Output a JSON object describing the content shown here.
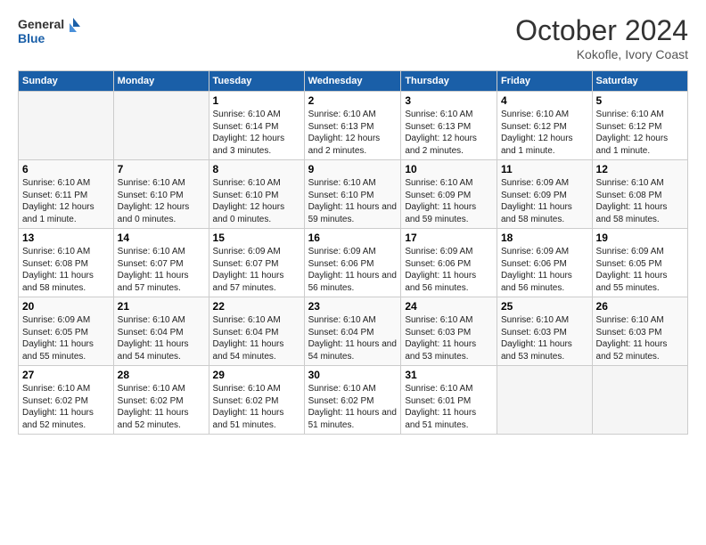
{
  "logo": {
    "line1": "General",
    "line2": "Blue"
  },
  "title": "October 2024",
  "location": "Kokofle, Ivory Coast",
  "days_of_week": [
    "Sunday",
    "Monday",
    "Tuesday",
    "Wednesday",
    "Thursday",
    "Friday",
    "Saturday"
  ],
  "weeks": [
    [
      {
        "day": "",
        "info": ""
      },
      {
        "day": "",
        "info": ""
      },
      {
        "day": "1",
        "info": "Sunrise: 6:10 AM\nSunset: 6:14 PM\nDaylight: 12 hours and 3 minutes."
      },
      {
        "day": "2",
        "info": "Sunrise: 6:10 AM\nSunset: 6:13 PM\nDaylight: 12 hours and 2 minutes."
      },
      {
        "day": "3",
        "info": "Sunrise: 6:10 AM\nSunset: 6:13 PM\nDaylight: 12 hours and 2 minutes."
      },
      {
        "day": "4",
        "info": "Sunrise: 6:10 AM\nSunset: 6:12 PM\nDaylight: 12 hours and 1 minute."
      },
      {
        "day": "5",
        "info": "Sunrise: 6:10 AM\nSunset: 6:12 PM\nDaylight: 12 hours and 1 minute."
      }
    ],
    [
      {
        "day": "6",
        "info": "Sunrise: 6:10 AM\nSunset: 6:11 PM\nDaylight: 12 hours and 1 minute."
      },
      {
        "day": "7",
        "info": "Sunrise: 6:10 AM\nSunset: 6:10 PM\nDaylight: 12 hours and 0 minutes."
      },
      {
        "day": "8",
        "info": "Sunrise: 6:10 AM\nSunset: 6:10 PM\nDaylight: 12 hours and 0 minutes."
      },
      {
        "day": "9",
        "info": "Sunrise: 6:10 AM\nSunset: 6:10 PM\nDaylight: 11 hours and 59 minutes."
      },
      {
        "day": "10",
        "info": "Sunrise: 6:10 AM\nSunset: 6:09 PM\nDaylight: 11 hours and 59 minutes."
      },
      {
        "day": "11",
        "info": "Sunrise: 6:09 AM\nSunset: 6:09 PM\nDaylight: 11 hours and 58 minutes."
      },
      {
        "day": "12",
        "info": "Sunrise: 6:10 AM\nSunset: 6:08 PM\nDaylight: 11 hours and 58 minutes."
      }
    ],
    [
      {
        "day": "13",
        "info": "Sunrise: 6:10 AM\nSunset: 6:08 PM\nDaylight: 11 hours and 58 minutes."
      },
      {
        "day": "14",
        "info": "Sunrise: 6:10 AM\nSunset: 6:07 PM\nDaylight: 11 hours and 57 minutes."
      },
      {
        "day": "15",
        "info": "Sunrise: 6:09 AM\nSunset: 6:07 PM\nDaylight: 11 hours and 57 minutes."
      },
      {
        "day": "16",
        "info": "Sunrise: 6:09 AM\nSunset: 6:06 PM\nDaylight: 11 hours and 56 minutes."
      },
      {
        "day": "17",
        "info": "Sunrise: 6:09 AM\nSunset: 6:06 PM\nDaylight: 11 hours and 56 minutes."
      },
      {
        "day": "18",
        "info": "Sunrise: 6:09 AM\nSunset: 6:06 PM\nDaylight: 11 hours and 56 minutes."
      },
      {
        "day": "19",
        "info": "Sunrise: 6:09 AM\nSunset: 6:05 PM\nDaylight: 11 hours and 55 minutes."
      }
    ],
    [
      {
        "day": "20",
        "info": "Sunrise: 6:09 AM\nSunset: 6:05 PM\nDaylight: 11 hours and 55 minutes."
      },
      {
        "day": "21",
        "info": "Sunrise: 6:10 AM\nSunset: 6:04 PM\nDaylight: 11 hours and 54 minutes."
      },
      {
        "day": "22",
        "info": "Sunrise: 6:10 AM\nSunset: 6:04 PM\nDaylight: 11 hours and 54 minutes."
      },
      {
        "day": "23",
        "info": "Sunrise: 6:10 AM\nSunset: 6:04 PM\nDaylight: 11 hours and 54 minutes."
      },
      {
        "day": "24",
        "info": "Sunrise: 6:10 AM\nSunset: 6:03 PM\nDaylight: 11 hours and 53 minutes."
      },
      {
        "day": "25",
        "info": "Sunrise: 6:10 AM\nSunset: 6:03 PM\nDaylight: 11 hours and 53 minutes."
      },
      {
        "day": "26",
        "info": "Sunrise: 6:10 AM\nSunset: 6:03 PM\nDaylight: 11 hours and 52 minutes."
      }
    ],
    [
      {
        "day": "27",
        "info": "Sunrise: 6:10 AM\nSunset: 6:02 PM\nDaylight: 11 hours and 52 minutes."
      },
      {
        "day": "28",
        "info": "Sunrise: 6:10 AM\nSunset: 6:02 PM\nDaylight: 11 hours and 52 minutes."
      },
      {
        "day": "29",
        "info": "Sunrise: 6:10 AM\nSunset: 6:02 PM\nDaylight: 11 hours and 51 minutes."
      },
      {
        "day": "30",
        "info": "Sunrise: 6:10 AM\nSunset: 6:02 PM\nDaylight: 11 hours and 51 minutes."
      },
      {
        "day": "31",
        "info": "Sunrise: 6:10 AM\nSunset: 6:01 PM\nDaylight: 11 hours and 51 minutes."
      },
      {
        "day": "",
        "info": ""
      },
      {
        "day": "",
        "info": ""
      }
    ]
  ]
}
